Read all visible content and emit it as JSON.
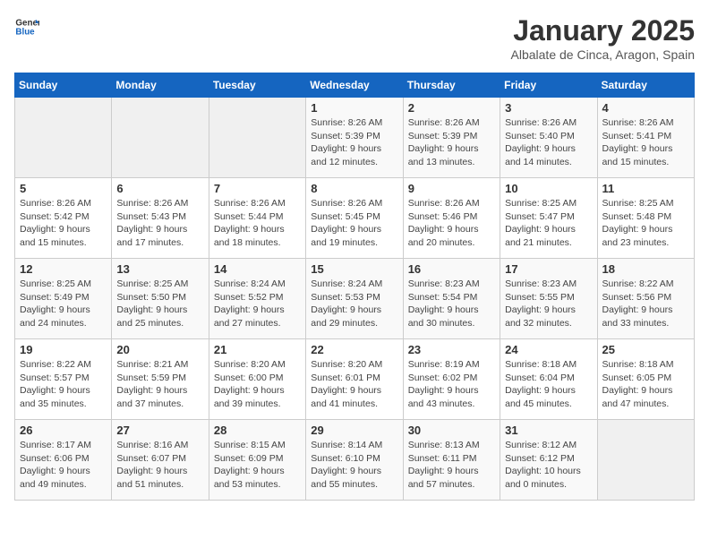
{
  "header": {
    "logo_general": "General",
    "logo_blue": "Blue",
    "title": "January 2025",
    "subtitle": "Albalate de Cinca, Aragon, Spain"
  },
  "weekdays": [
    "Sunday",
    "Monday",
    "Tuesday",
    "Wednesday",
    "Thursday",
    "Friday",
    "Saturday"
  ],
  "weeks": [
    [
      {
        "day": "",
        "sunrise": "",
        "sunset": "",
        "daylight": ""
      },
      {
        "day": "",
        "sunrise": "",
        "sunset": "",
        "daylight": ""
      },
      {
        "day": "",
        "sunrise": "",
        "sunset": "",
        "daylight": ""
      },
      {
        "day": "1",
        "sunrise": "Sunrise: 8:26 AM",
        "sunset": "Sunset: 5:39 PM",
        "daylight": "Daylight: 9 hours and 12 minutes."
      },
      {
        "day": "2",
        "sunrise": "Sunrise: 8:26 AM",
        "sunset": "Sunset: 5:39 PM",
        "daylight": "Daylight: 9 hours and 13 minutes."
      },
      {
        "day": "3",
        "sunrise": "Sunrise: 8:26 AM",
        "sunset": "Sunset: 5:40 PM",
        "daylight": "Daylight: 9 hours and 14 minutes."
      },
      {
        "day": "4",
        "sunrise": "Sunrise: 8:26 AM",
        "sunset": "Sunset: 5:41 PM",
        "daylight": "Daylight: 9 hours and 15 minutes."
      }
    ],
    [
      {
        "day": "5",
        "sunrise": "Sunrise: 8:26 AM",
        "sunset": "Sunset: 5:42 PM",
        "daylight": "Daylight: 9 hours and 15 minutes."
      },
      {
        "day": "6",
        "sunrise": "Sunrise: 8:26 AM",
        "sunset": "Sunset: 5:43 PM",
        "daylight": "Daylight: 9 hours and 17 minutes."
      },
      {
        "day": "7",
        "sunrise": "Sunrise: 8:26 AM",
        "sunset": "Sunset: 5:44 PM",
        "daylight": "Daylight: 9 hours and 18 minutes."
      },
      {
        "day": "8",
        "sunrise": "Sunrise: 8:26 AM",
        "sunset": "Sunset: 5:45 PM",
        "daylight": "Daylight: 9 hours and 19 minutes."
      },
      {
        "day": "9",
        "sunrise": "Sunrise: 8:26 AM",
        "sunset": "Sunset: 5:46 PM",
        "daylight": "Daylight: 9 hours and 20 minutes."
      },
      {
        "day": "10",
        "sunrise": "Sunrise: 8:25 AM",
        "sunset": "Sunset: 5:47 PM",
        "daylight": "Daylight: 9 hours and 21 minutes."
      },
      {
        "day": "11",
        "sunrise": "Sunrise: 8:25 AM",
        "sunset": "Sunset: 5:48 PM",
        "daylight": "Daylight: 9 hours and 23 minutes."
      }
    ],
    [
      {
        "day": "12",
        "sunrise": "Sunrise: 8:25 AM",
        "sunset": "Sunset: 5:49 PM",
        "daylight": "Daylight: 9 hours and 24 minutes."
      },
      {
        "day": "13",
        "sunrise": "Sunrise: 8:25 AM",
        "sunset": "Sunset: 5:50 PM",
        "daylight": "Daylight: 9 hours and 25 minutes."
      },
      {
        "day": "14",
        "sunrise": "Sunrise: 8:24 AM",
        "sunset": "Sunset: 5:52 PM",
        "daylight": "Daylight: 9 hours and 27 minutes."
      },
      {
        "day": "15",
        "sunrise": "Sunrise: 8:24 AM",
        "sunset": "Sunset: 5:53 PM",
        "daylight": "Daylight: 9 hours and 29 minutes."
      },
      {
        "day": "16",
        "sunrise": "Sunrise: 8:23 AM",
        "sunset": "Sunset: 5:54 PM",
        "daylight": "Daylight: 9 hours and 30 minutes."
      },
      {
        "day": "17",
        "sunrise": "Sunrise: 8:23 AM",
        "sunset": "Sunset: 5:55 PM",
        "daylight": "Daylight: 9 hours and 32 minutes."
      },
      {
        "day": "18",
        "sunrise": "Sunrise: 8:22 AM",
        "sunset": "Sunset: 5:56 PM",
        "daylight": "Daylight: 9 hours and 33 minutes."
      }
    ],
    [
      {
        "day": "19",
        "sunrise": "Sunrise: 8:22 AM",
        "sunset": "Sunset: 5:57 PM",
        "daylight": "Daylight: 9 hours and 35 minutes."
      },
      {
        "day": "20",
        "sunrise": "Sunrise: 8:21 AM",
        "sunset": "Sunset: 5:59 PM",
        "daylight": "Daylight: 9 hours and 37 minutes."
      },
      {
        "day": "21",
        "sunrise": "Sunrise: 8:20 AM",
        "sunset": "Sunset: 6:00 PM",
        "daylight": "Daylight: 9 hours and 39 minutes."
      },
      {
        "day": "22",
        "sunrise": "Sunrise: 8:20 AM",
        "sunset": "Sunset: 6:01 PM",
        "daylight": "Daylight: 9 hours and 41 minutes."
      },
      {
        "day": "23",
        "sunrise": "Sunrise: 8:19 AM",
        "sunset": "Sunset: 6:02 PM",
        "daylight": "Daylight: 9 hours and 43 minutes."
      },
      {
        "day": "24",
        "sunrise": "Sunrise: 8:18 AM",
        "sunset": "Sunset: 6:04 PM",
        "daylight": "Daylight: 9 hours and 45 minutes."
      },
      {
        "day": "25",
        "sunrise": "Sunrise: 8:18 AM",
        "sunset": "Sunset: 6:05 PM",
        "daylight": "Daylight: 9 hours and 47 minutes."
      }
    ],
    [
      {
        "day": "26",
        "sunrise": "Sunrise: 8:17 AM",
        "sunset": "Sunset: 6:06 PM",
        "daylight": "Daylight: 9 hours and 49 minutes."
      },
      {
        "day": "27",
        "sunrise": "Sunrise: 8:16 AM",
        "sunset": "Sunset: 6:07 PM",
        "daylight": "Daylight: 9 hours and 51 minutes."
      },
      {
        "day": "28",
        "sunrise": "Sunrise: 8:15 AM",
        "sunset": "Sunset: 6:09 PM",
        "daylight": "Daylight: 9 hours and 53 minutes."
      },
      {
        "day": "29",
        "sunrise": "Sunrise: 8:14 AM",
        "sunset": "Sunset: 6:10 PM",
        "daylight": "Daylight: 9 hours and 55 minutes."
      },
      {
        "day": "30",
        "sunrise": "Sunrise: 8:13 AM",
        "sunset": "Sunset: 6:11 PM",
        "daylight": "Daylight: 9 hours and 57 minutes."
      },
      {
        "day": "31",
        "sunrise": "Sunrise: 8:12 AM",
        "sunset": "Sunset: 6:12 PM",
        "daylight": "Daylight: 10 hours and 0 minutes."
      },
      {
        "day": "",
        "sunrise": "",
        "sunset": "",
        "daylight": ""
      }
    ]
  ]
}
